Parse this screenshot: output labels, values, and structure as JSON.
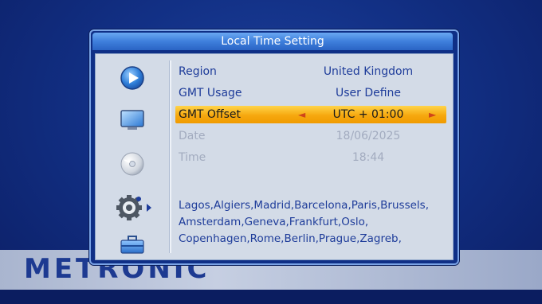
{
  "brand": "METRONIC",
  "dialog": {
    "title": "Local Time Setting"
  },
  "menu_icons": [
    {
      "name": "media-play-icon"
    },
    {
      "name": "tv-screen-icon"
    },
    {
      "name": "disc-icon"
    },
    {
      "name": "settings-gear-icon",
      "selected": true
    },
    {
      "name": "toolbox-icon"
    }
  ],
  "settings": [
    {
      "label": "Region",
      "value": "United Kingdom",
      "state": "active"
    },
    {
      "label": "GMT Usage",
      "value": "User Define",
      "state": "active"
    },
    {
      "label": "GMT Offset",
      "value": "UTC + 01:00",
      "state": "selected"
    },
    {
      "label": "Date",
      "value": "18/06/2025",
      "state": "disabled"
    },
    {
      "label": "Time",
      "value": "18:44",
      "state": "disabled"
    }
  ],
  "arrows": {
    "left": "◄",
    "right": "►"
  },
  "cities": [
    "Lagos,Algiers,Madrid,Barcelona,Paris,Brussels,",
    "Amsterdam,Geneva,Frankfurt,Oslo,",
    "Copenhagen,Rome,Berlin,Prague,Zagreb,"
  ],
  "colors": {
    "background": "#123085",
    "titlebar": "#3f7fdc",
    "panel": "#d3dbe7",
    "highlight": "#f6a80f",
    "text": "#1e3c9a",
    "disabled_text": "#a2abbf"
  }
}
